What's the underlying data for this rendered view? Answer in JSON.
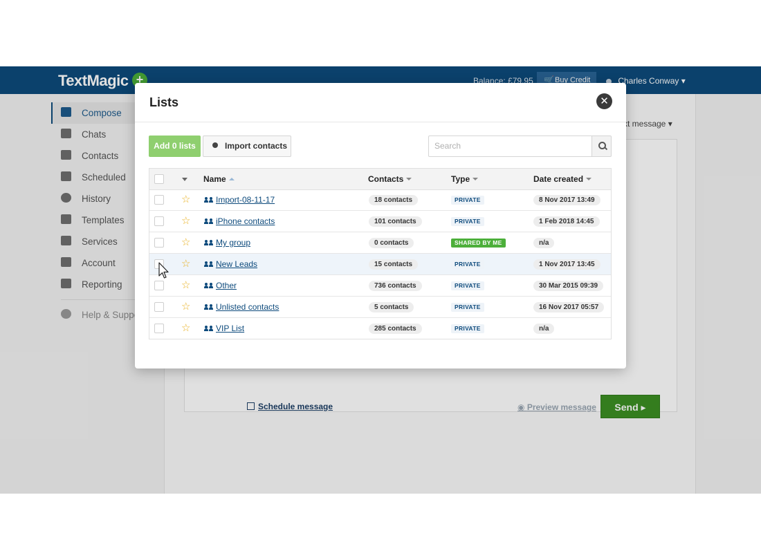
{
  "app": {
    "logo": "TextMagic",
    "balance": "Balance: £79.95",
    "buy_credit": "Buy Credit",
    "user_name": "Charles Conway",
    "user_caret": "▾"
  },
  "sidebar": {
    "items": [
      {
        "label": "Compose",
        "icon": "compose-icon",
        "active": true
      },
      {
        "label": "Chats",
        "icon": "chat-icon"
      },
      {
        "label": "Contacts",
        "icon": "contacts-icon"
      },
      {
        "label": "Scheduled",
        "icon": "calendar-icon"
      },
      {
        "label": "History",
        "icon": "history-icon"
      },
      {
        "label": "Templates",
        "icon": "clipboard-icon"
      },
      {
        "label": "Services",
        "icon": "services-icon"
      },
      {
        "label": "Account",
        "icon": "account-icon"
      },
      {
        "label": "Reporting",
        "icon": "bar-chart-icon"
      }
    ],
    "help": "Help & Support"
  },
  "background": {
    "text_message_dropdown": "xt message ▾",
    "schedule_message": "Schedule message",
    "preview_message": "Preview message",
    "send": "Send ▸"
  },
  "modal": {
    "title": "Lists",
    "close": "✕",
    "add_button": "Add 0 lists",
    "import_button": "Import contacts",
    "search_placeholder": "Search",
    "columns": {
      "name": "Name",
      "contacts": "Contacts",
      "type": "Type",
      "date_created": "Date created"
    },
    "rows": [
      {
        "name": "Import-08-11-17",
        "contacts": "18 contacts",
        "type": "PRIVATE",
        "date": "8 Nov 2017 13:49"
      },
      {
        "name": "iPhone contacts",
        "contacts": "101 contacts",
        "type": "PRIVATE",
        "date": "1 Feb 2018 14:45"
      },
      {
        "name": "My group",
        "contacts": "0 contacts",
        "type": "SHARED BY ME",
        "date": "n/a"
      },
      {
        "name": "New Leads",
        "contacts": "15 contacts",
        "type": "PRIVATE",
        "date": "1 Nov 2017 13:45"
      },
      {
        "name": "Other",
        "contacts": "736 contacts",
        "type": "PRIVATE",
        "date": "30 Mar 2015 09:39"
      },
      {
        "name": "Unlisted contacts",
        "contacts": "5 contacts",
        "type": "PRIVATE",
        "date": "16 Nov 2017 05:57"
      },
      {
        "name": "VIP List",
        "contacts": "285 contacts",
        "type": "PRIVATE",
        "date": "n/a"
      }
    ]
  },
  "colors": {
    "topbar": "#0d4a7c",
    "send_green": "#3c8f23",
    "add_green": "#8fcf6f",
    "star": "#e8b020",
    "shared_badge": "#4caf3a"
  }
}
